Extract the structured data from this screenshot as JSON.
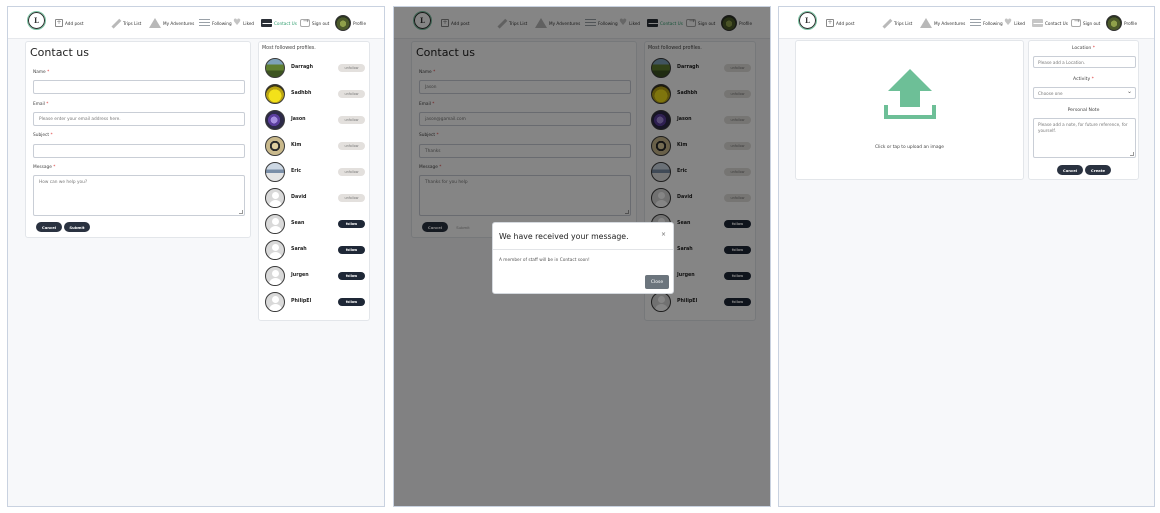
{
  "nav": {
    "logo_letter": "L",
    "add_post": "Add post",
    "trips_list": "Trips List",
    "my_adventures": "My Adventures",
    "following": "Following",
    "liked": "Liked",
    "contact_us": "Contact Us",
    "sign_out": "Sign out",
    "profile": "Profile",
    "active_color": "#2e9d6d"
  },
  "contact_form": {
    "title": "Contact us",
    "name_label": "Name",
    "email_label": "Email",
    "subject_label": "Subject",
    "message_label": "Message",
    "required_mark": "*",
    "name_value": "",
    "email_placeholder": "Please enter your email address here.",
    "subject_value": "",
    "message_placeholder": "How can we help you?",
    "cancel": "Cancel",
    "submit": "Submit"
  },
  "contact_form_filled": {
    "name_value": "Jason",
    "email_value": "jason@gamail.com",
    "subject_value": "Thanks",
    "message_value": "Thanks for you help",
    "cancel": "Cancel",
    "submit": "Submit"
  },
  "profiles": {
    "title": "Most followed profiles.",
    "items": [
      {
        "name": "Darragh",
        "action": "unfollow"
      },
      {
        "name": "Sadhbh",
        "action": "unfollow"
      },
      {
        "name": "Jason",
        "action": "unfollow"
      },
      {
        "name": "Kim",
        "action": "unfollow"
      },
      {
        "name": "Eric",
        "action": "unfollow"
      },
      {
        "name": "David",
        "action": "unfollow"
      },
      {
        "name": "Sean",
        "action": "follow"
      },
      {
        "name": "Sarah",
        "action": "follow"
      },
      {
        "name": "Jurgen",
        "action": "follow"
      },
      {
        "name": "PhilipEl",
        "action": "follow"
      }
    ]
  },
  "modal": {
    "title": "We have received your message.",
    "close_x": "×",
    "body": "A member of staff will be in Contact soon!",
    "close_button": "Close"
  },
  "create_post": {
    "upload_text": "Click or tap to upload an image",
    "location_label": "Location",
    "location_placeholder": "Please add a Location.",
    "activity_label": "Activity",
    "activity_value": "Choose one",
    "note_label": "Personal Note",
    "note_placeholder": "Please add a note, for future reference, for yourself.",
    "cancel": "Cancel",
    "create": "Create",
    "upload_icon_color": "#6dbf97"
  }
}
